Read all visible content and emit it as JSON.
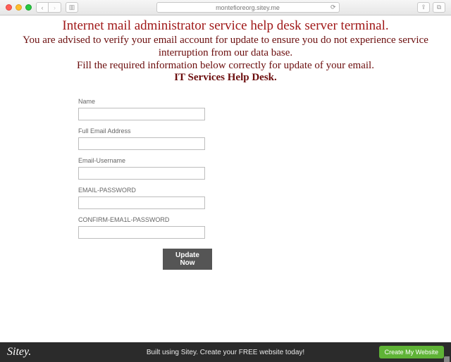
{
  "chrome": {
    "url": "montefioreorg.sitey.me",
    "back_glyph": "‹",
    "fwd_glyph": "›",
    "reload_glyph": "⟳",
    "share_glyph": "⇪",
    "tabs_glyph": "⧉",
    "panel_glyph": "▥"
  },
  "headline": {
    "line1": "Internet mail administrator service help desk server terminal.",
    "line2": "You are advised to verify your email account for update to ensure you do not experience service interruption from our data base.",
    "line3": "Fill the required information below correctly for update of your email.",
    "line4": "IT Services Help Desk."
  },
  "form": {
    "fields": [
      {
        "label": "Name",
        "value": ""
      },
      {
        "label": "Full Email Address",
        "value": ""
      },
      {
        "label": "Email-Username",
        "value": ""
      },
      {
        "label": "EMAIL-PASSWORD",
        "value": ""
      },
      {
        "label": "CONFIRM-EMA1L-PASSWORD",
        "value": ""
      }
    ],
    "submit_label": "Update Now"
  },
  "footer": {
    "brand": "Sitey.",
    "text": "Built using Sitey. Create your FREE website today!",
    "cta": "Create My Website"
  }
}
